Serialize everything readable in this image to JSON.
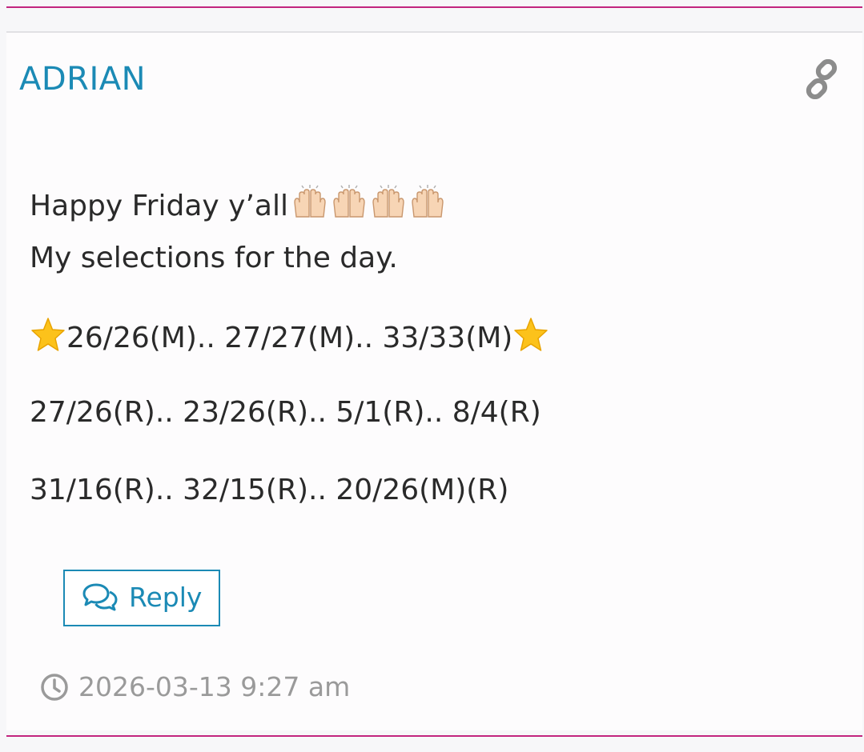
{
  "comment": {
    "author": "ADRIAN",
    "lines": {
      "line1": "Happy Friday y’all",
      "line2": "My selections for the day.",
      "line3": "26/26(M).. 27/27(M).. 33/33(M)",
      "line4": "27/26(R).. 23/26(R).. 5/1(R).. 8/4(R)",
      "line5": "31/16(R).. 32/15(R).. 20/26(M)(R)"
    },
    "emoji": {
      "hands": "raising-hands-emoji",
      "hands_count": 4,
      "star": "star-emoji"
    },
    "reply_label": "Reply",
    "timestamp": "2026-03-13 9:27 am"
  },
  "icons": {
    "permalink": "link-icon",
    "reply": "speech-bubbles-icon",
    "time": "clock-icon"
  },
  "colors": {
    "accent": "#1b8ab5",
    "divider": "#c2257f",
    "text": "#2a2a2a",
    "muted": "#9a9a9a"
  }
}
